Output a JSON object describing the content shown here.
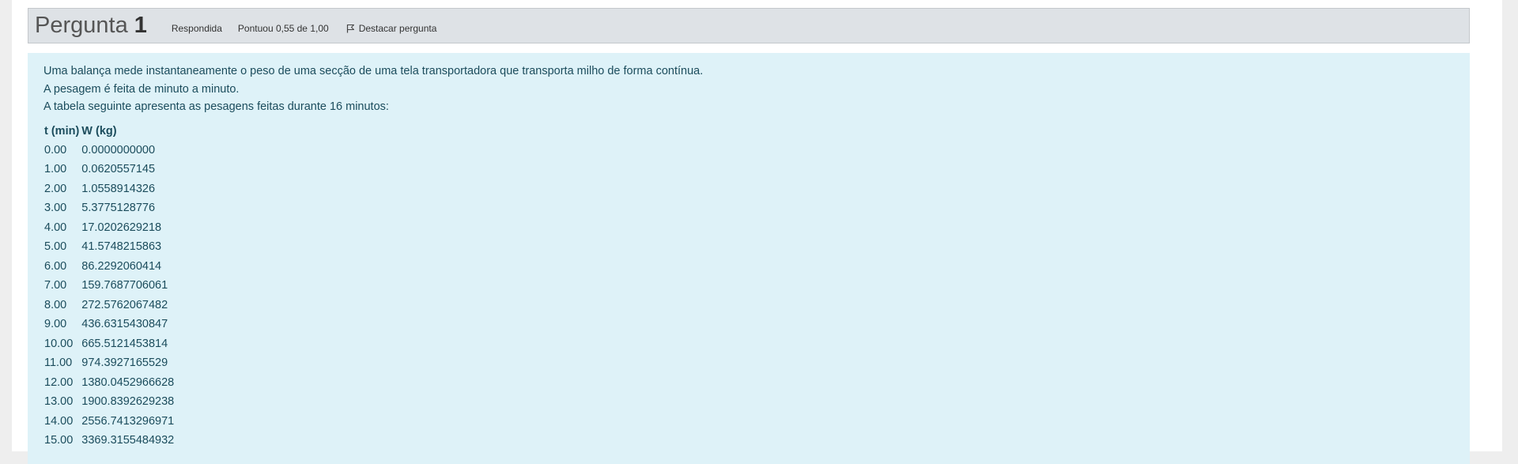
{
  "question": {
    "label": "Pergunta",
    "number": "1",
    "state": "Respondida",
    "grade": "Pontuou 0,55 de 1,00",
    "flag_label": "Destacar pergunta",
    "flag_icon": "flag-icon"
  },
  "content": {
    "paragraphs": [
      "Uma balança mede instantaneamente o peso de uma secção de uma tela transportadora que transporta milho de forma contínua.",
      "A pesagem é feita de minuto a minuto.",
      "A tabela seguinte apresenta as pesagens feitas durante 16 minutos:"
    ],
    "table": {
      "headers": [
        "t (min)",
        "W (kg)"
      ],
      "rows": [
        [
          "0.00",
          "0.0000000000"
        ],
        [
          "1.00",
          "0.0620557145"
        ],
        [
          "2.00",
          "1.0558914326"
        ],
        [
          "3.00",
          "5.3775128776"
        ],
        [
          "4.00",
          "17.0202629218"
        ],
        [
          "5.00",
          "41.5748215863"
        ],
        [
          "6.00",
          "86.2292060414"
        ],
        [
          "7.00",
          "159.7687706061"
        ],
        [
          "8.00",
          "272.5762067482"
        ],
        [
          "9.00",
          "436.6315430847"
        ],
        [
          "10.00",
          "665.5121453814"
        ],
        [
          "11.00",
          "974.3927165529"
        ],
        [
          "12.00",
          "1380.0452966628"
        ],
        [
          "13.00",
          "1900.8392629238"
        ],
        [
          "14.00",
          "2556.7413296971"
        ],
        [
          "15.00",
          "3369.3155484932"
        ]
      ]
    }
  },
  "colors": {
    "info_bar": "#dee2e6",
    "content_bg": "#def2f8",
    "content_text": "#1b4c5c"
  }
}
